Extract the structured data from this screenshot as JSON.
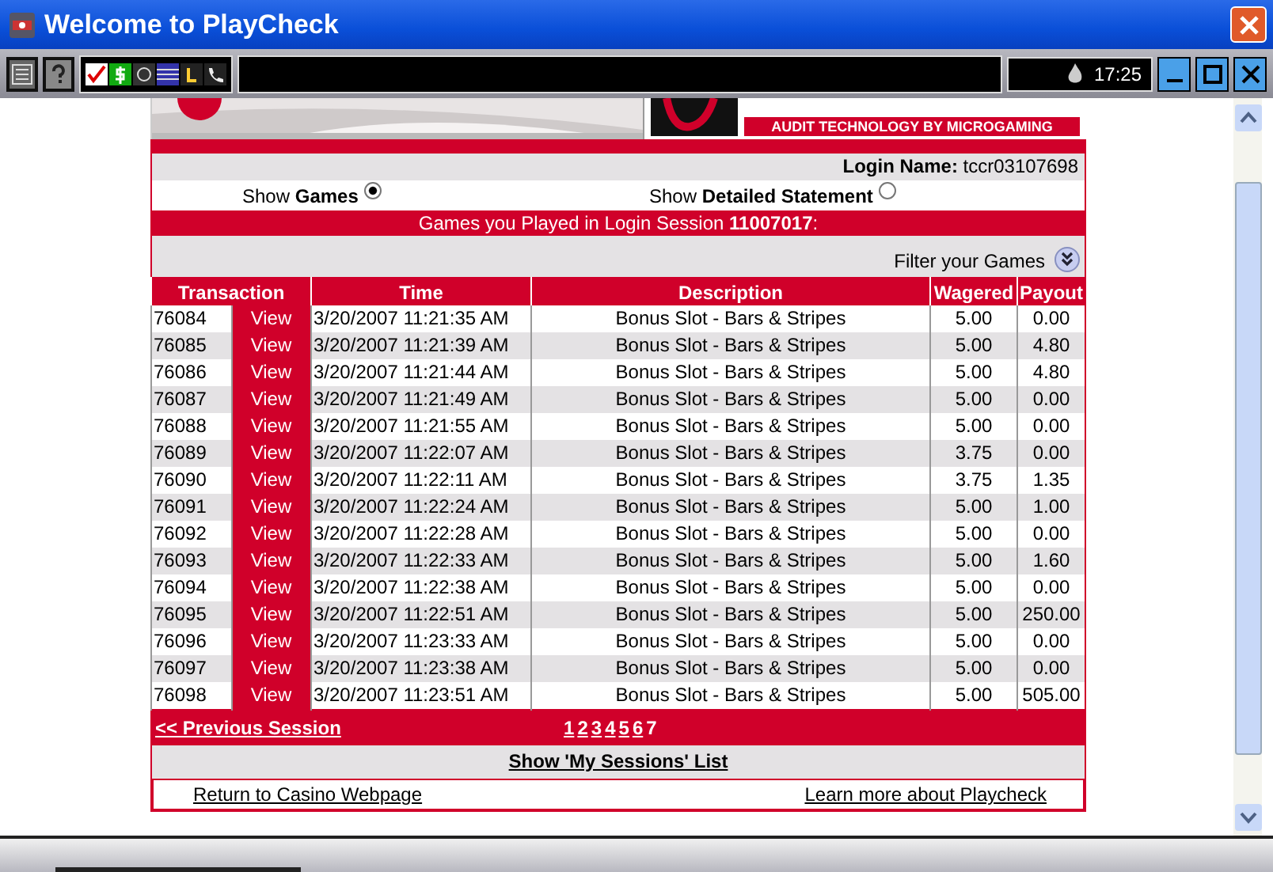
{
  "window": {
    "title": "Welcome to PlayCheck",
    "clock": "17:25"
  },
  "banner": {
    "tagline": "AUDIT TECHNOLOGY BY MICROGAMING"
  },
  "login": {
    "label": "Login Name:",
    "value": "tccr03107698"
  },
  "views": [
    {
      "prefix": "Show",
      "label": "Games",
      "selected": true
    },
    {
      "prefix": "Show",
      "label": "Detailed Statement",
      "selected": false
    }
  ],
  "heading": {
    "text": "Games you Played in Login Session **11007017**:"
  },
  "filter": {
    "label": "Filter your Games"
  },
  "table": {
    "columns": [
      "Transaction",
      "Time",
      "Description",
      "Wagered",
      "Payout"
    ],
    "rows": [
      {
        "id": "76084",
        "link": "View",
        "time": "3/20/2007 11:21:35 AM",
        "description": "Bonus Slot - Bars & Stripes",
        "wagered": "5.00",
        "payout": "0.00"
      },
      {
        "id": "76085",
        "link": "View",
        "time": "3/20/2007 11:21:39 AM",
        "description": "Bonus Slot - Bars & Stripes",
        "wagered": "5.00",
        "payout": "4.80"
      },
      {
        "id": "76086",
        "link": "View",
        "time": "3/20/2007 11:21:44 AM",
        "description": "Bonus Slot - Bars & Stripes",
        "wagered": "5.00",
        "payout": "4.80"
      },
      {
        "id": "76087",
        "link": "View",
        "time": "3/20/2007 11:21:49 AM",
        "description": "Bonus Slot - Bars & Stripes",
        "wagered": "5.00",
        "payout": "0.00"
      },
      {
        "id": "76088",
        "link": "View",
        "time": "3/20/2007 11:21:55 AM",
        "description": "Bonus Slot - Bars & Stripes",
        "wagered": "5.00",
        "payout": "0.00"
      },
      {
        "id": "76089",
        "link": "View",
        "time": "3/20/2007 11:22:07 AM",
        "description": "Bonus Slot - Bars & Stripes",
        "wagered": "3.75",
        "payout": "0.00"
      },
      {
        "id": "76090",
        "link": "View",
        "time": "3/20/2007 11:22:11 AM",
        "description": "Bonus Slot - Bars & Stripes",
        "wagered": "3.75",
        "payout": "1.35"
      },
      {
        "id": "76091",
        "link": "View",
        "time": "3/20/2007 11:22:24 AM",
        "description": "Bonus Slot - Bars & Stripes",
        "wagered": "5.00",
        "payout": "1.00"
      },
      {
        "id": "76092",
        "link": "View",
        "time": "3/20/2007 11:22:28 AM",
        "description": "Bonus Slot - Bars & Stripes",
        "wagered": "5.00",
        "payout": "0.00"
      },
      {
        "id": "76093",
        "link": "View",
        "time": "3/20/2007 11:22:33 AM",
        "description": "Bonus Slot - Bars & Stripes",
        "wagered": "5.00",
        "payout": "1.60"
      },
      {
        "id": "76094",
        "link": "View",
        "time": "3/20/2007 11:22:38 AM",
        "description": "Bonus Slot - Bars & Stripes",
        "wagered": "5.00",
        "payout": "0.00"
      },
      {
        "id": "76095",
        "link": "View",
        "time": "3/20/2007 11:22:51 AM",
        "description": "Bonus Slot - Bars & Stripes",
        "wagered": "5.00",
        "payout": "250.00"
      },
      {
        "id": "76096",
        "link": "View",
        "time": "3/20/2007 11:23:33 AM",
        "description": "Bonus Slot - Bars & Stripes",
        "wagered": "5.00",
        "payout": "0.00"
      },
      {
        "id": "76097",
        "link": "View",
        "time": "3/20/2007 11:23:38 AM",
        "description": "Bonus Slot - Bars & Stripes",
        "wagered": "5.00",
        "payout": "0.00"
      },
      {
        "id": "76098",
        "link": "View",
        "time": "3/20/2007 11:23:51 AM",
        "description": "Bonus Slot - Bars & Stripes",
        "wagered": "5.00",
        "payout": "505.00"
      }
    ]
  },
  "pager": {
    "previous": "<< Previous Session",
    "pages": [
      {
        "label": "1",
        "selected": false
      },
      {
        "label": "2",
        "selected": false
      },
      {
        "label": "3",
        "selected": false
      },
      {
        "label": "4",
        "selected": false
      },
      {
        "label": "5",
        "selected": false
      },
      {
        "label": "6",
        "selected": false
      },
      {
        "label": "7",
        "selected": true
      }
    ]
  },
  "sessions_link": "Show 'My Sessions' List",
  "footer": {
    "left": "Return to Casino Webpage",
    "right": "Learn more about Playcheck"
  }
}
